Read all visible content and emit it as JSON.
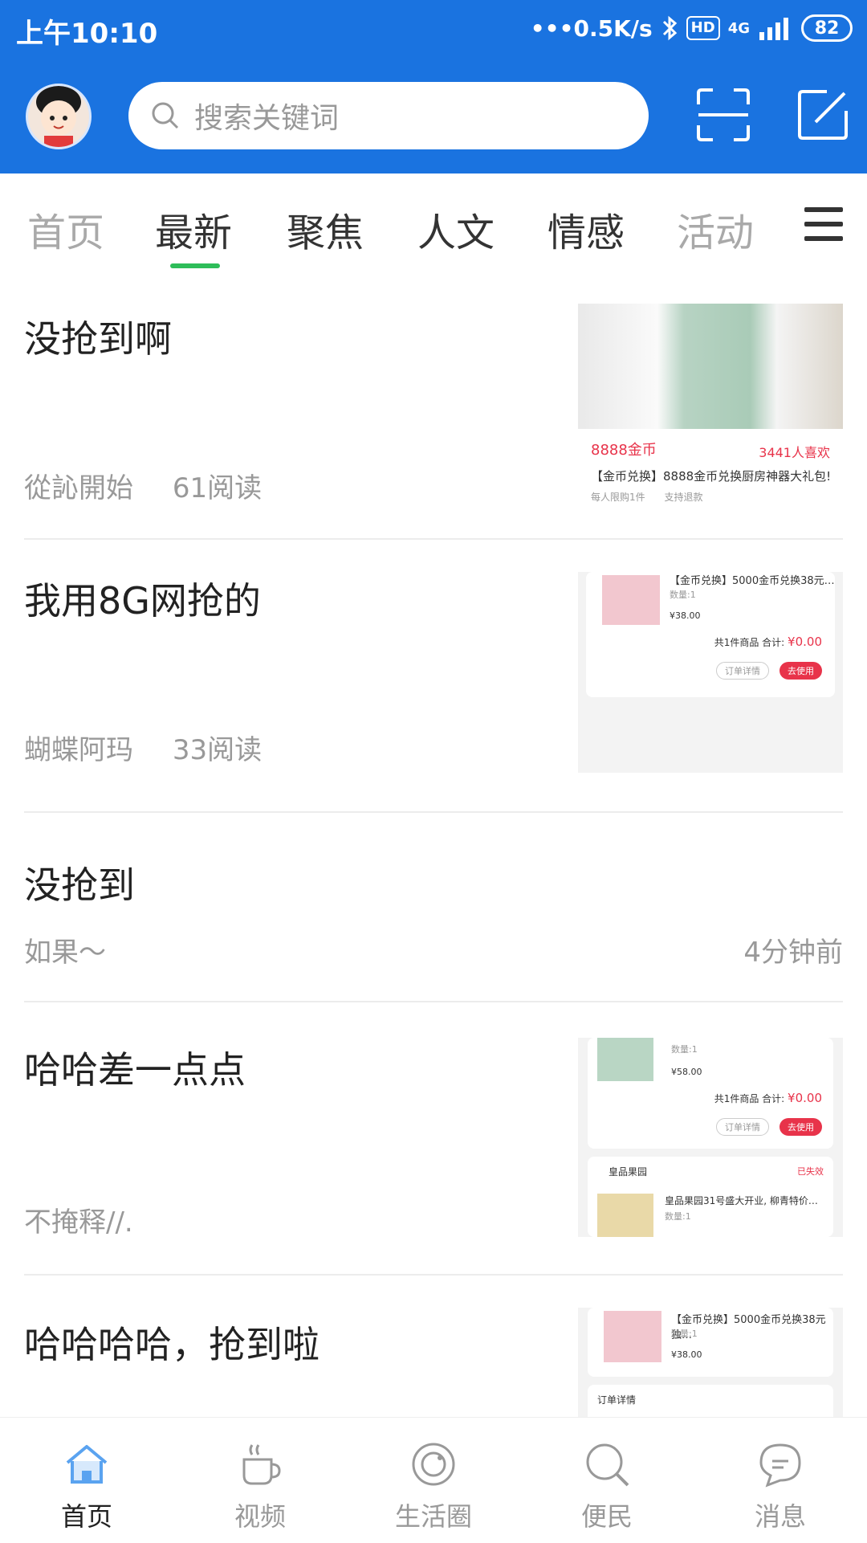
{
  "status_bar": {
    "time": "上午10:10",
    "speed": "•••0.5K/s",
    "hd": "HD",
    "network": "4G",
    "battery": "82"
  },
  "header": {
    "search_placeholder": "搜索关键词"
  },
  "tabs": [
    {
      "label": "首页"
    },
    {
      "label": "最新"
    },
    {
      "label": "聚焦"
    },
    {
      "label": "人文"
    },
    {
      "label": "情感"
    },
    {
      "label": "活动"
    }
  ],
  "feed": [
    {
      "title": "没抢到啊",
      "author": "從訫開始",
      "reads": "61阅读",
      "thumb": {
        "price": "8888金币",
        "likes": "3441人喜欢",
        "desc": "【金币兑换】8888金币兑换厨房神器大礼包!",
        "note1": "每人限购1件",
        "note2": "支持退款"
      }
    },
    {
      "title": "我用8G网抢的",
      "author": "蝴蝶阿玛",
      "reads": "33阅读",
      "thumb": {
        "line1": "【金币兑换】5000金币兑换38元…",
        "qty": "数量:1",
        "price": "¥38.00",
        "summary": "共1件商品  合计:",
        "total": "¥0.00",
        "btn1": "订单详情",
        "btn2": "去使用"
      }
    },
    {
      "title": "没抢到",
      "author": "如果～",
      "time": "4分钟前"
    },
    {
      "title": "哈哈差一点点",
      "author": "不掩释//.",
      "thumb": {
        "qty": "数量:1",
        "price": "¥58.00",
        "summary": "共1件商品  合计:",
        "total": "¥0.00",
        "btn1": "订单详情",
        "btn2": "去使用",
        "shop": "皇品果园",
        "status": "已失效",
        "line2": "皇品果园31号盛大开业, 柳青特价…",
        "qty2": "数量:1"
      }
    },
    {
      "title": "哈哈哈哈，抢到啦",
      "thumb": {
        "line1": "【金币兑换】5000金币兑换38元独…",
        "qty": "数量:1",
        "price": "¥38.00",
        "order": "订单详情"
      }
    }
  ],
  "bottom_nav": [
    {
      "label": "首页",
      "icon": "home-icon"
    },
    {
      "label": "视频",
      "icon": "coffee-icon"
    },
    {
      "label": "生活圈",
      "icon": "circle-icon"
    },
    {
      "label": "便民",
      "icon": "search-icon"
    },
    {
      "label": "消息",
      "icon": "message-icon"
    }
  ],
  "colors": {
    "brand": "#1a73e0",
    "tab_indicator": "#2ebd59",
    "price_red": "#e8334a"
  }
}
